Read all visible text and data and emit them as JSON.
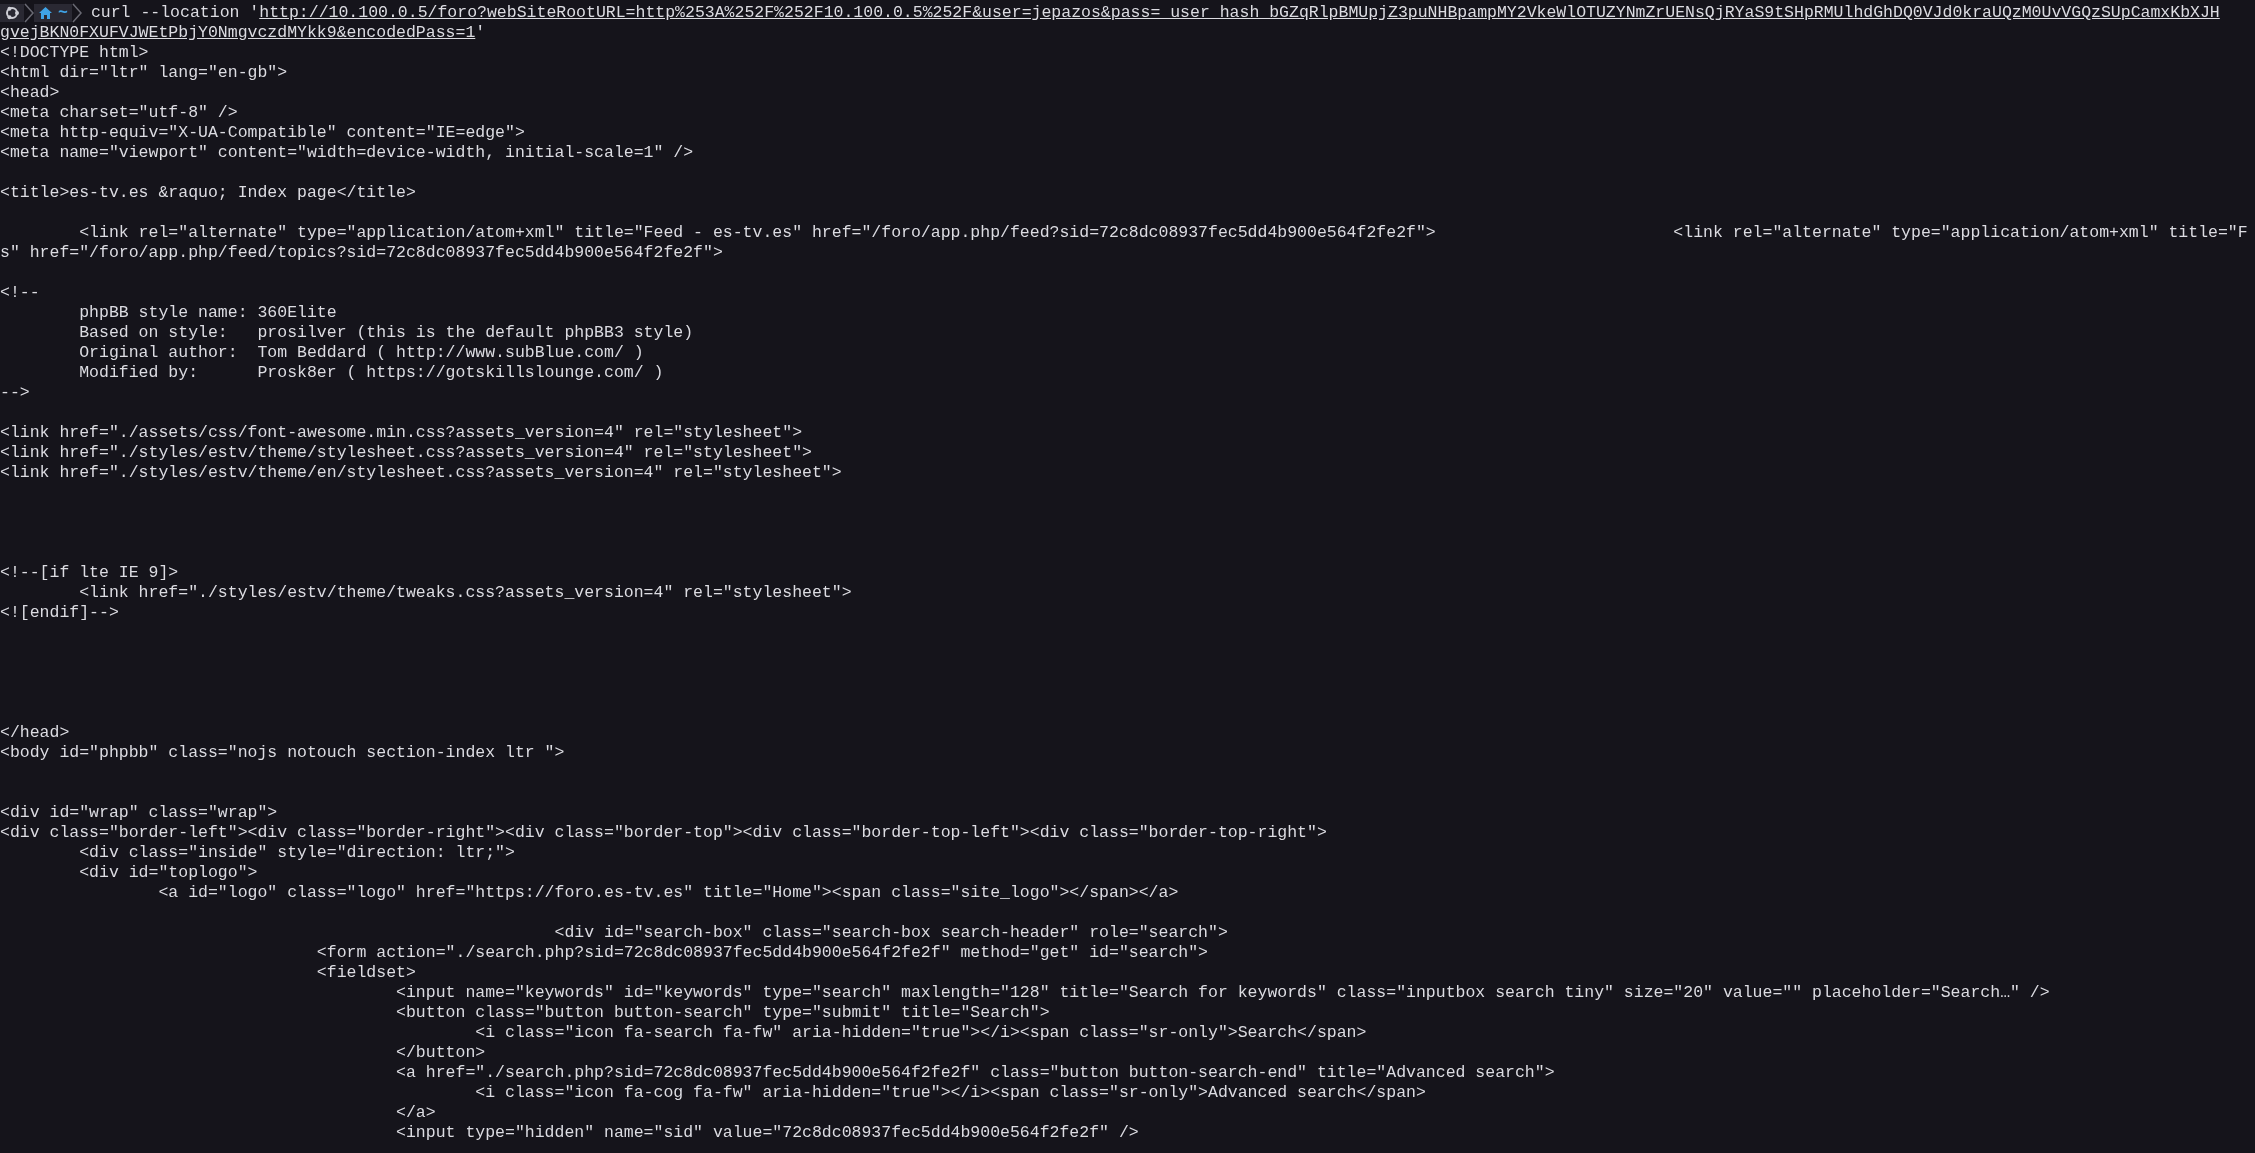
{
  "terminal": {
    "prompt": {
      "path": "~"
    },
    "command": {
      "text": "curl --location '",
      "url": "http://10.100.0.5/foro?webSiteRootURL=http%253A%252F%252F10.100.0.5%252F&user=jepazos&pass=_user_hash_bGZqRlpBMUpjZ3puNHBpampMY2VkeWlOTUZYNmZrUENsQjRYaS9tSHpRMUlhdGhDQ0VJd0kraUQzM0UvVGQzSUpCamxKbXJH",
      "url_continued": "gvejBKN0FXUFVJWEtPbjY0NmgvczdMYkk9&encodedPass=1",
      "closing": "'"
    },
    "output": [
      {
        "kind": "text",
        "text": "<!DOCTYPE html>"
      },
      {
        "kind": "text",
        "text": "<html dir=\"ltr\" lang=\"en-gb\">"
      },
      {
        "kind": "text",
        "text": "<head>"
      },
      {
        "kind": "text",
        "text": "<meta charset=\"utf-8\" />"
      },
      {
        "kind": "text",
        "text": "<meta http-equiv=\"X-UA-Compatible\" content=\"IE=edge\">"
      },
      {
        "kind": "text",
        "text": "<meta name=\"viewport\" content=\"width=device-width, initial-scale=1\" />"
      },
      {
        "kind": "blank"
      },
      {
        "kind": "text",
        "text": "<title>es-tv.es &raquo; Index page</title>"
      },
      {
        "kind": "blank"
      },
      {
        "kind": "text",
        "text": "        <link rel=\"alternate\" type=\"application/atom+xml\" title=\"Feed - es-tv.es\" href=\"/foro/app.php/feed?sid=72c8dc08937fec5dd4b900e564f2fe2f\">                        <link rel=\"alternate\" type=\"application/atom+xml\" title=\"F"
      },
      {
        "kind": "text",
        "text": "s\" href=\"/foro/app.php/feed/topics?sid=72c8dc08937fec5dd4b900e564f2fe2f\">"
      },
      {
        "kind": "blank"
      },
      {
        "kind": "text",
        "text": "<!--"
      },
      {
        "kind": "text",
        "text": "        phpBB style name: 360Elite"
      },
      {
        "kind": "text",
        "text": "        Based on style:   prosilver (this is the default phpBB3 style)"
      },
      {
        "kind": "text",
        "text": "        Original author:  Tom Beddard ( http://www.subBlue.com/ )"
      },
      {
        "kind": "text",
        "text": "        Modified by:      Prosk8er ( https://gotskillslounge.com/ )"
      },
      {
        "kind": "text",
        "text": "-->"
      },
      {
        "kind": "blank"
      },
      {
        "kind": "text",
        "text": "<link href=\"./assets/css/font-awesome.min.css?assets_version=4\" rel=\"stylesheet\">"
      },
      {
        "kind": "text",
        "text": "<link href=\"./styles/estv/theme/stylesheet.css?assets_version=4\" rel=\"stylesheet\">"
      },
      {
        "kind": "text",
        "text": "<link href=\"./styles/estv/theme/en/stylesheet.css?assets_version=4\" rel=\"stylesheet\">"
      },
      {
        "kind": "blank"
      },
      {
        "kind": "blank"
      },
      {
        "kind": "blank"
      },
      {
        "kind": "blank"
      },
      {
        "kind": "text",
        "text": "<!--[if lte IE 9]>"
      },
      {
        "kind": "text",
        "text": "        <link href=\"./styles/estv/theme/tweaks.css?assets_version=4\" rel=\"stylesheet\">"
      },
      {
        "kind": "text",
        "text": "<![endif]-->"
      },
      {
        "kind": "blank"
      },
      {
        "kind": "blank"
      },
      {
        "kind": "blank"
      },
      {
        "kind": "blank"
      },
      {
        "kind": "blank"
      },
      {
        "kind": "text",
        "text": "</head>"
      },
      {
        "kind": "text",
        "text": "<body id=\"phpbb\" class=\"nojs notouch section-index ltr \">"
      },
      {
        "kind": "blank"
      },
      {
        "kind": "blank"
      },
      {
        "kind": "text",
        "text": "<div id=\"wrap\" class=\"wrap\">"
      },
      {
        "kind": "text",
        "text": "<div class=\"border-left\"><div class=\"border-right\"><div class=\"border-top\"><div class=\"border-top-left\"><div class=\"border-top-right\">"
      },
      {
        "kind": "text",
        "text": "        <div class=\"inside\" style=\"direction: ltr;\">"
      },
      {
        "kind": "text",
        "text": "        <div id=\"toplogo\">"
      },
      {
        "kind": "text",
        "text": "                <a id=\"logo\" class=\"logo\" href=\"https://foro.es-tv.es\" title=\"Home\"><span class=\"site_logo\"></span></a>"
      },
      {
        "kind": "blank"
      },
      {
        "kind": "text",
        "text": "                                                        <div id=\"search-box\" class=\"search-box search-header\" role=\"search\">"
      },
      {
        "kind": "text",
        "text": "                                <form action=\"./search.php?sid=72c8dc08937fec5dd4b900e564f2fe2f\" method=\"get\" id=\"search\">"
      },
      {
        "kind": "text",
        "text": "                                <fieldset>"
      },
      {
        "kind": "text",
        "text": "                                        <input name=\"keywords\" id=\"keywords\" type=\"search\" maxlength=\"128\" title=\"Search for keywords\" class=\"inputbox search tiny\" size=\"20\" value=\"\" placeholder=\"Search…\" />"
      },
      {
        "kind": "text",
        "text": "                                        <button class=\"button button-search\" type=\"submit\" title=\"Search\">"
      },
      {
        "kind": "text",
        "text": "                                                <i class=\"icon fa-search fa-fw\" aria-hidden=\"true\"></i><span class=\"sr-only\">Search</span>"
      },
      {
        "kind": "text",
        "text": "                                        </button>"
      },
      {
        "kind": "text",
        "text": "                                        <a href=\"./search.php?sid=72c8dc08937fec5dd4b900e564f2fe2f\" class=\"button button-search-end\" title=\"Advanced search\">"
      },
      {
        "kind": "text",
        "text": "                                                <i class=\"icon fa-cog fa-fw\" aria-hidden=\"true\"></i><span class=\"sr-only\">Advanced search</span>"
      },
      {
        "kind": "text",
        "text": "                                        </a>"
      },
      {
        "kind": "text",
        "text": "                                        <input type=\"hidden\" name=\"sid\" value=\"72c8dc08937fec5dd4b900e564f2fe2f\" />"
      }
    ]
  }
}
